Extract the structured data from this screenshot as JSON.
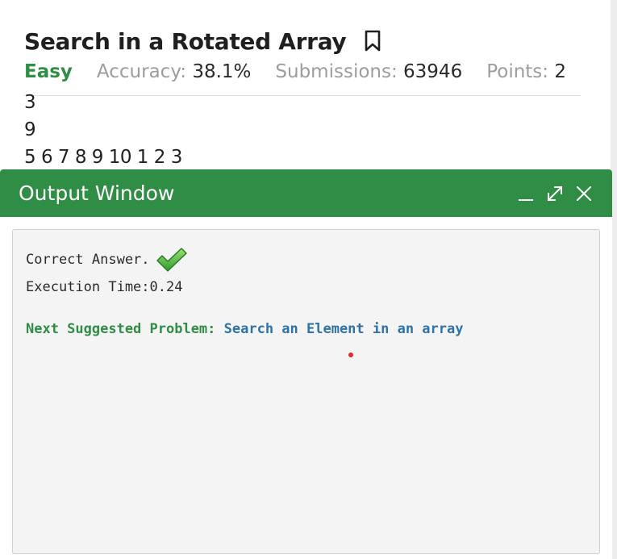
{
  "problem": {
    "title": "Search in a Rotated Array",
    "difficulty": "Easy",
    "accuracy_label": "Accuracy:",
    "accuracy_value": "38.1%",
    "submissions_label": "Submissions:",
    "submissions_value": "63946",
    "points_label": "Points:",
    "points_value": "2"
  },
  "input_lines": [
    "3",
    "9",
    "5 6 7 8 9 10 1 2 3"
  ],
  "output_window": {
    "title": "Output Window",
    "result_text": "Correct Answer.",
    "execution_time": "Execution Time:0.24",
    "suggest_label": "Next Suggested Problem:",
    "suggest_link": "Search an Element in an array"
  },
  "colors": {
    "brand_green": "#2f8d46",
    "link_blue": "#2f72a8",
    "cursor_red": "#d92b2b"
  },
  "icons": [
    "bookmark-icon",
    "minimize-icon",
    "maximize-icon",
    "close-icon",
    "checkmark-icon"
  ]
}
